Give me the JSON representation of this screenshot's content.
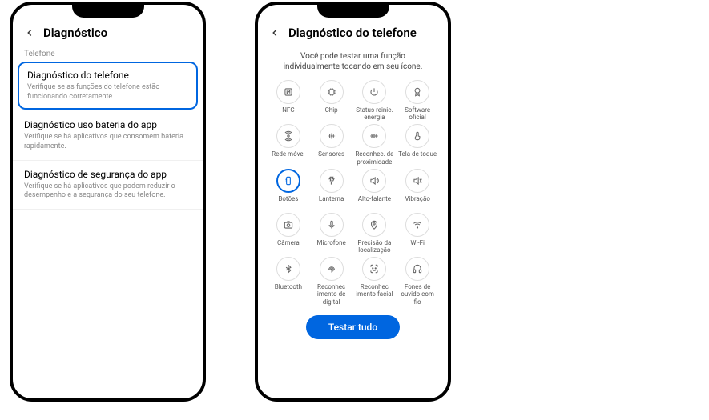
{
  "phone1": {
    "title": "Diagnóstico",
    "section": "Telefone",
    "items": [
      {
        "title": "Diagnóstico do telefone",
        "sub": "Verifique se as funções do telefone estão funcionando corretamente."
      },
      {
        "title": "Diagnóstico uso bateria do app",
        "sub": "Verifique se há aplicativos que consomem bateria rapidamente."
      },
      {
        "title": "Diagnóstico de segurança do app",
        "sub": "Verifique se há aplicativos que podem reduzir o desempenho e a segurança do seu telefone."
      }
    ]
  },
  "phone2": {
    "title": "Diagnóstico do telefone",
    "intro": "Você pode testar uma função individualmente tocando em seu ícone.",
    "grid": [
      {
        "label": "NFC",
        "icon": "nfc"
      },
      {
        "label": "Chip",
        "icon": "chip"
      },
      {
        "label": "Status reinic. energia",
        "icon": "power"
      },
      {
        "label": "Software oficial",
        "icon": "badge"
      },
      {
        "label": "Rede móvel",
        "icon": "signal"
      },
      {
        "label": "Sensores",
        "icon": "sensors"
      },
      {
        "label": "Reconhec. de proximidade",
        "icon": "prox"
      },
      {
        "label": "Tela de toque",
        "icon": "touch"
      },
      {
        "label": "Botões",
        "icon": "buttons",
        "selected": true
      },
      {
        "label": "Lanterna",
        "icon": "flash"
      },
      {
        "label": "Alto-falante",
        "icon": "speaker"
      },
      {
        "label": "Vibração",
        "icon": "vibrate"
      },
      {
        "label": "Câmera",
        "icon": "camera"
      },
      {
        "label": "Microfone",
        "icon": "mic"
      },
      {
        "label": "Precisão da localização",
        "icon": "location"
      },
      {
        "label": "Wi-Fi",
        "icon": "wifi"
      },
      {
        "label": "Bluetooth",
        "icon": "bt"
      },
      {
        "label": "Reconhec imento de digital",
        "icon": "finger"
      },
      {
        "label": "Reconhec imento facial",
        "icon": "face"
      },
      {
        "label": "Fones de ouvido com fio",
        "icon": "headphones"
      }
    ],
    "test_btn": "Testar tudo"
  }
}
